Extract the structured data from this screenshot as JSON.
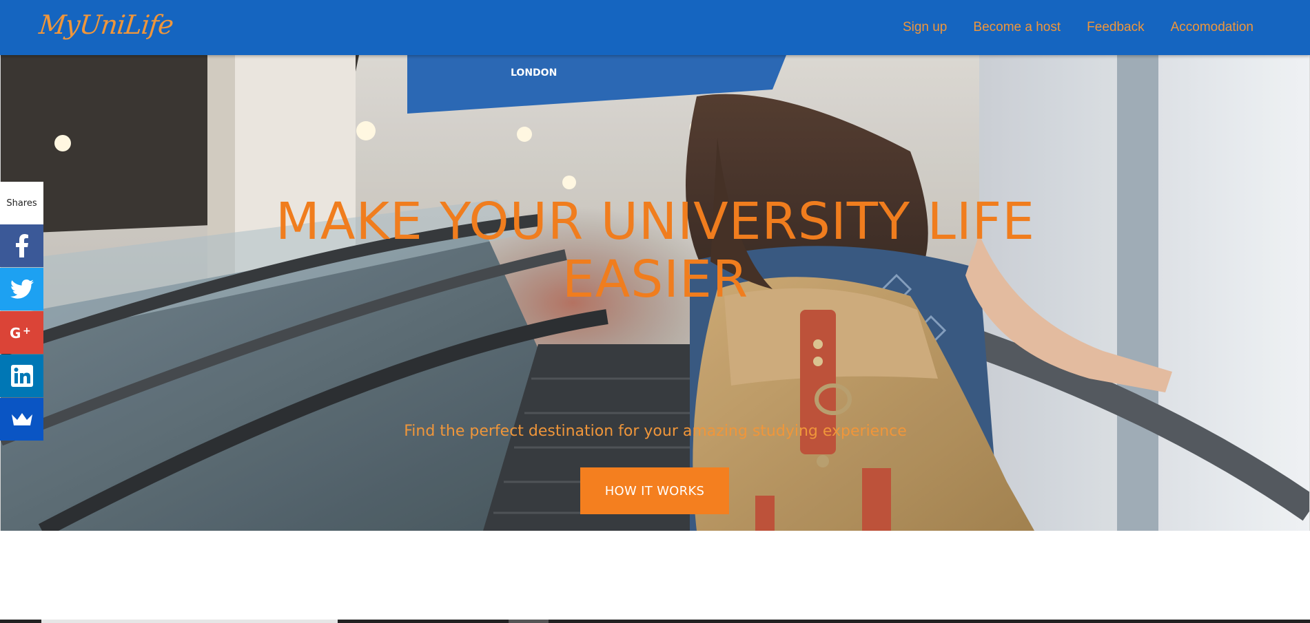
{
  "brand": {
    "logo_text": "MyUniLife"
  },
  "nav": {
    "items": [
      {
        "label": "Sign up"
      },
      {
        "label": "Become a host"
      },
      {
        "label": "Feedback"
      },
      {
        "label": "Accomodation"
      }
    ]
  },
  "hero": {
    "title_line1": "MAKE YOUR UNIVERSITY LIFE",
    "title_line2": "EASIER",
    "subtitle": "Find the perfect destination for your amazing studying experience",
    "cta_label": "HOW IT WORKS",
    "sign_text": "LONDON"
  },
  "share": {
    "label": "Shares",
    "buttons": [
      {
        "icon": "facebook-icon",
        "color": "#3b5998"
      },
      {
        "icon": "twitter-icon",
        "color": "#1da1f2"
      },
      {
        "icon": "google-plus-icon",
        "color": "#db4437"
      },
      {
        "icon": "linkedin-icon",
        "color": "#0077b5"
      },
      {
        "icon": "sumome-crown-icon",
        "color": "#0a55c4"
      }
    ]
  },
  "colors": {
    "navbar": "#1565c0",
    "accent": "#f47f1f",
    "link": "#f0963a"
  }
}
